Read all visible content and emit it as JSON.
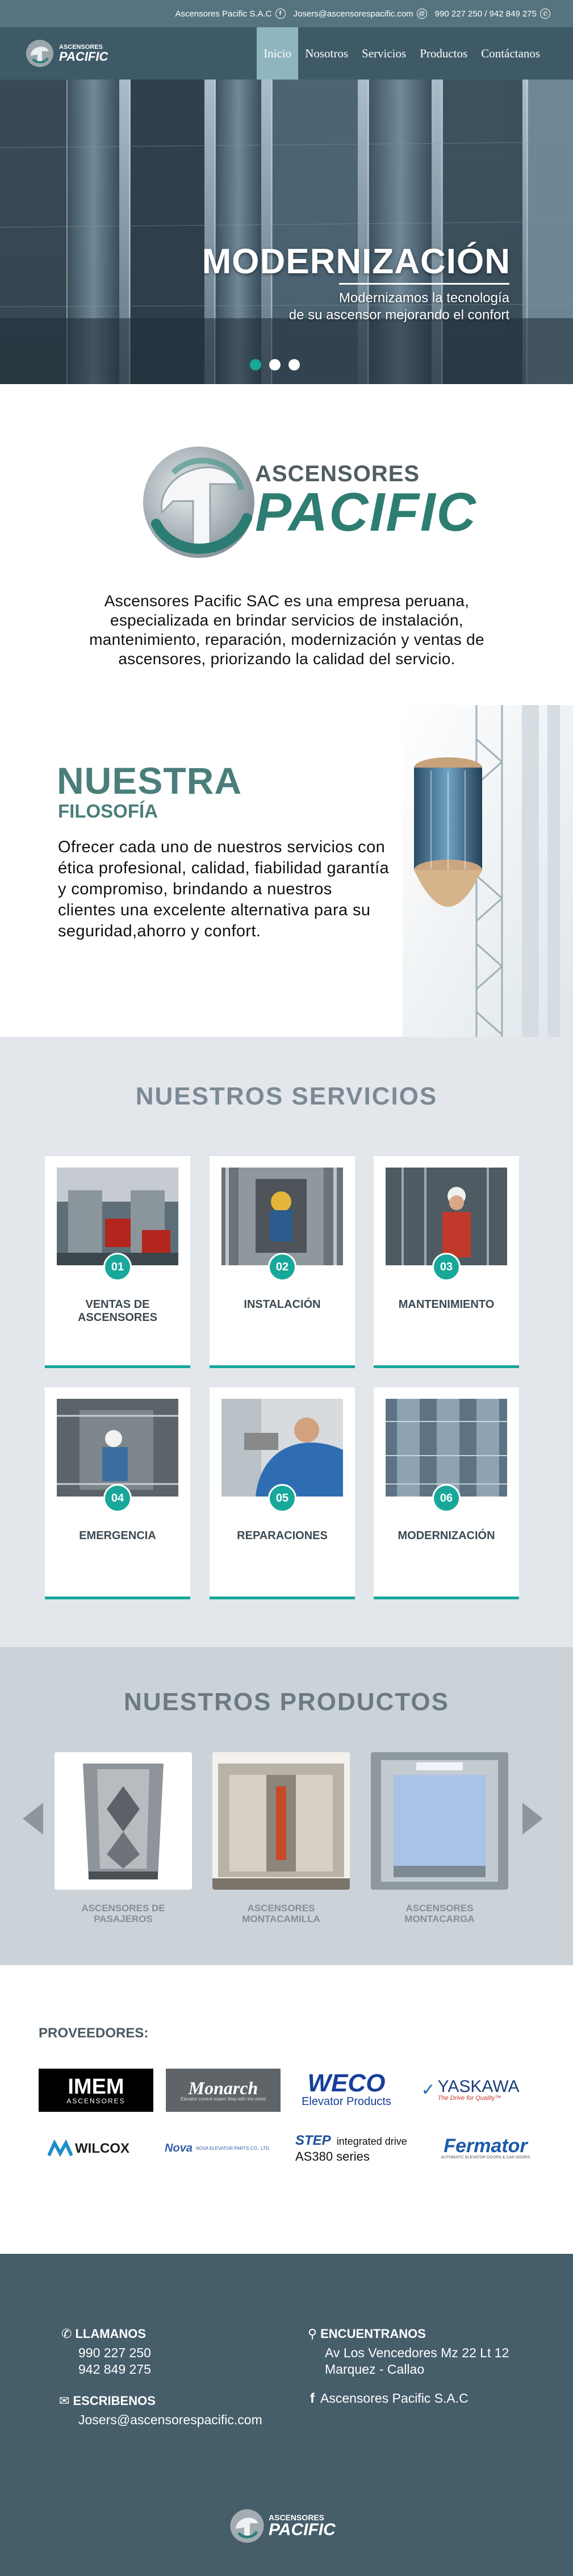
{
  "topbar": {
    "company": "Ascensores Pacific S.A.C",
    "email": "Josers@ascensorespacific.com",
    "phones": "990 227 250 / 942 849 275"
  },
  "nav": {
    "logo_small": "ASCENSORES",
    "logo_big": "PACIFIC",
    "items": [
      "Inicio",
      "Nosotros",
      "Servicios",
      "Productos",
      "Contáctanos"
    ],
    "active": "Inicio"
  },
  "hero": {
    "title": "MODERNIZACIÓN",
    "subtitle_line1": "Modernizamos la tecnología",
    "subtitle_line2": "de su ascensor mejorando el confort",
    "slides": 3,
    "active_slide": 1
  },
  "about": {
    "logo_small": "ASCENSORES",
    "logo_big": "PACIFIC",
    "text": "Ascensores Pacific SAC es una empresa peruana, especializada en brindar servicios de  instalación, mantenimiento, reparación, modernización y ventas de ascensores, priorizando la calidad del servicio."
  },
  "philosophy": {
    "title": "NUESTRA",
    "subtitle": "FILOSOFÍA",
    "text": "Ofrecer cada uno de nuestros servicios con ética profesional, calidad, fiabilidad garantía y compromiso, brindando a nuestros clientes una excelente alternativa para su  seguridad,ahorro y confort."
  },
  "services": {
    "title": "NUESTROS  SERVICIOS",
    "items": [
      {
        "num": "01",
        "label": "VENTAS DE ASCENSORES"
      },
      {
        "num": "02",
        "label": "INSTALACIÓN"
      },
      {
        "num": "03",
        "label": "MANTENIMIENTO"
      },
      {
        "num": "04",
        "label": "EMERGENCIA"
      },
      {
        "num": "05",
        "label": "REPARACIONES"
      },
      {
        "num": "06",
        "label": "MODERNIZACIÓN"
      }
    ]
  },
  "products": {
    "title": "NUESTROS  PRODUCTOS",
    "items": [
      {
        "label": "ASCENSORES DE PASAJEROS"
      },
      {
        "label": "ASCENSORES MONTACAMILLA"
      },
      {
        "label": "ASCENSORES MONTACARGA"
      }
    ]
  },
  "suppliers": {
    "title": "PROVEEDORES:",
    "brands": {
      "imem": "IMEM",
      "imem_sub": "ASCENSORES",
      "monarch": "Monarch",
      "monarch_sub": "Elevator control expert Step with the world",
      "weco": "WECO",
      "weco_sub": "Elevator Products",
      "yaskawa": "YASKAWA",
      "yaskawa_sub": "The Drive for Quality™",
      "wilcox": "WILCOX",
      "nova": "Nova",
      "nova_sub": "NOVA ELEVATOR PARTS CO., LTD.",
      "step": "STEP",
      "step_sub1": "integrated drive",
      "step_sub2": "AS380 series",
      "fermator": "Fermator",
      "fermator_sub": "AUTOMATIC ELEVATOR DOORS & CAR DOORS"
    }
  },
  "footer": {
    "call_title": "LLAMANOS",
    "phone1": "990 227 250",
    "phone2": "942 849 275",
    "write_title": "ESCRIBENOS",
    "email": "Josers@ascensorespacific.com",
    "find_title": "ENCUENTRANOS",
    "address1": "Av Los Vencedores Mz 22 Lt 12",
    "address2": "Marquez - Callao",
    "facebook": "Ascensores Pacific S.A.C",
    "logo_small": "ASCENSORES",
    "logo_big": "PACIFIC"
  },
  "colors": {
    "accent": "#17a89a",
    "nav_bg": "#3e5a67",
    "topbar_bg": "#56747f",
    "footer_bg": "#465d6a",
    "heading_teal": "#4a7e7a"
  }
}
